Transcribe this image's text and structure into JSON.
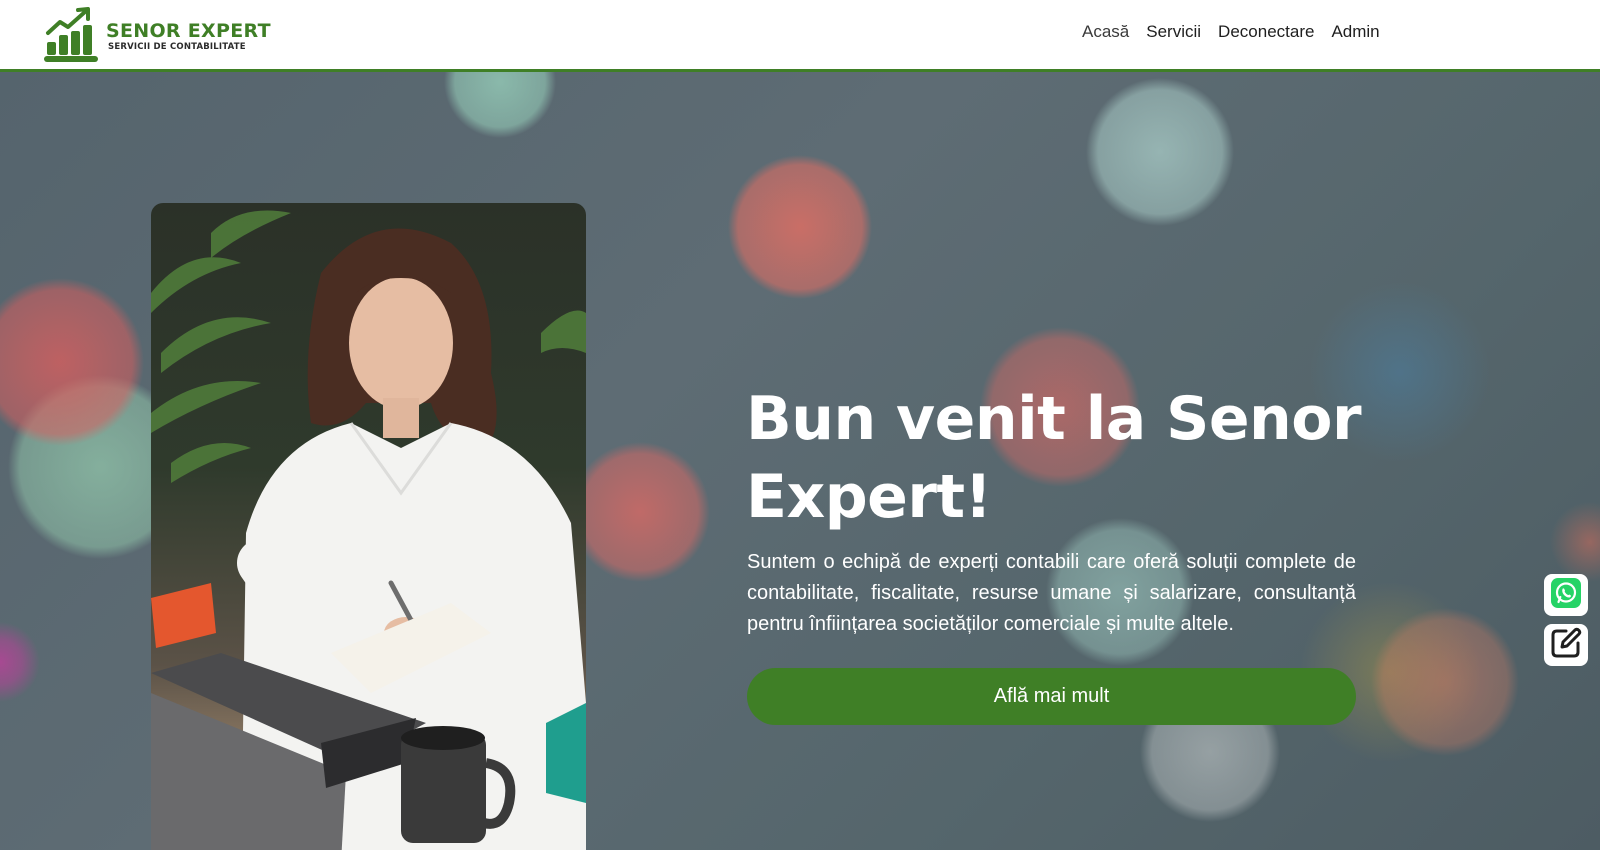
{
  "brand": {
    "name": "SENOR EXPERT",
    "tagline": "SERVICII DE CONTABILITATE",
    "logo_icon": "growth-chart-icon",
    "color": "#3f7f26"
  },
  "nav": {
    "items": [
      {
        "label": "Acasă",
        "active": true
      },
      {
        "label": "Servicii",
        "active": false
      },
      {
        "label": "Deconectare",
        "active": false
      },
      {
        "label": "Admin",
        "active": false
      }
    ]
  },
  "hero": {
    "title": "Bun venit la Senor Expert!",
    "description": "Suntem o echipă de experți contabili care oferă soluții complete de contabilitate, fiscalitate, resurse umane și salarizare, consultanță pentru înființarea societăților comerciale și multe altele.",
    "cta_label": "Află mai mult",
    "image_subject": "woman-writing-at-laptop"
  },
  "floating_actions": {
    "whatsapp_icon": "whatsapp-icon",
    "edit_icon": "edit-icon",
    "whatsapp_color": "#25d366"
  }
}
